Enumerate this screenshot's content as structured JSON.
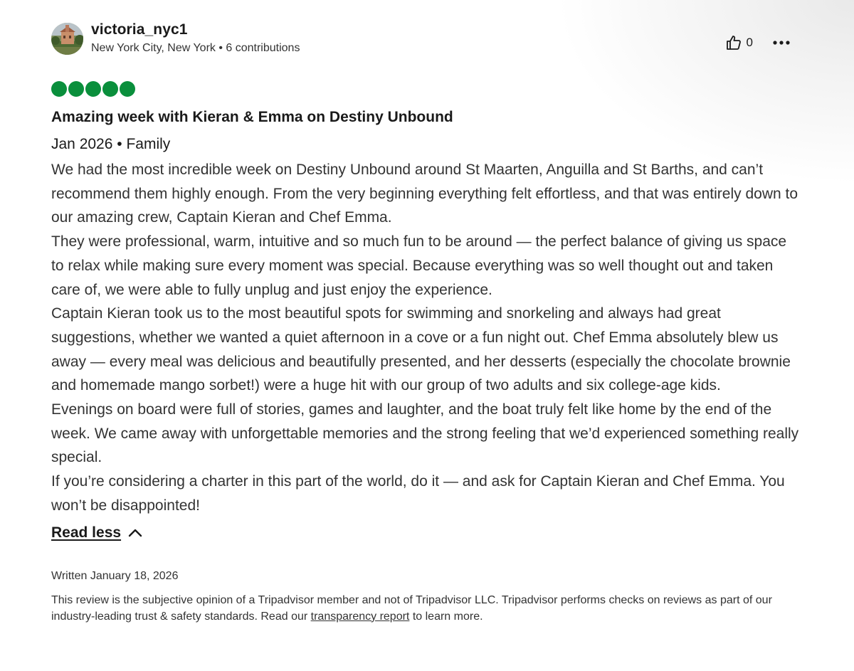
{
  "user": {
    "name": "victoria_nyc1",
    "location": "New York City, New York",
    "separator": " • ",
    "contributions": "6 contributions",
    "avatar_icon": "profile-photo"
  },
  "actions": {
    "like_icon": "thumbs-up-icon",
    "like_count": "0",
    "more_icon": "ellipsis-icon"
  },
  "rating": {
    "value": 5,
    "max": 5,
    "color": "#0a8f3c"
  },
  "review": {
    "title": "Amazing week with Kieran & Emma on Destiny Unbound",
    "trip_date": "Jan 2026",
    "trip_type": "Family",
    "meta_separator": " • ",
    "paragraphs": [
      "We had the most incredible week on Destiny Unbound around St Maarten, Anguilla and St Barths, and can’t recommend them highly enough. From the very beginning everything felt effortless, and that was entirely down to our amazing crew, Captain Kieran and Chef Emma.",
      "They were professional, warm, intuitive and so much fun to be around — the perfect balance of giving us space to relax while making sure every moment was special. Because everything was so well thought out and taken care of, we were able to fully unplug and just enjoy the experience.",
      "Captain Kieran took us to the most beautiful spots for swimming and snorkeling and always had great suggestions, whether we wanted a quiet afternoon in a cove or a fun night out. Chef Emma absolutely blew us away — every meal was delicious and beautifully presented, and her desserts (especially the chocolate brownie and homemade mango sorbet!) were a huge hit with our group of two adults and six college-age kids.",
      "Evenings on board were full of stories, games and laughter, and the boat truly felt like home by the end of the week. We came away with unforgettable memories and the strong feeling that we’d experienced something really special.",
      "If you’re considering a charter in this part of the world, do it — and ask for Captain Kieran and Chef Emma. You won’t be disappointed!"
    ],
    "read_less_label": "Read less",
    "read_less_icon": "chevron-up-icon",
    "written": "Written January 18, 2026"
  },
  "disclaimer": {
    "before_link": "This review is the subjective opinion of a Tripadvisor member and not of Tripadvisor LLC. Tripadvisor performs checks on reviews as part of our industry-leading trust & safety standards. Read our ",
    "link_text": "transparency report",
    "after_link": " to learn more."
  }
}
